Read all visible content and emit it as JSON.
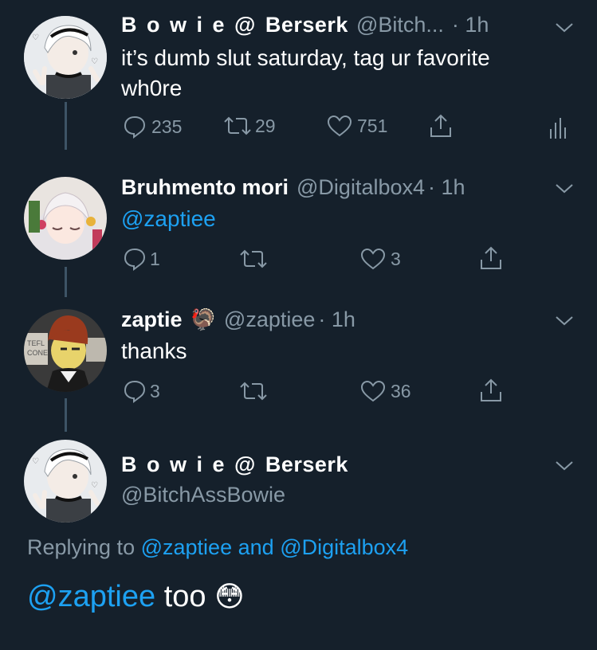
{
  "tweets": [
    {
      "name": "B o w i  e @ Berserk",
      "handle": "@Bitch...",
      "time": "· 1h",
      "text_lines": [
        "it’s dumb slut saturday, tag ur favorite",
        "wh0re"
      ],
      "replies": "235",
      "retweets": "29",
      "likes": "751"
    },
    {
      "name": "Bruhmento mori",
      "handle": "@Digitalbox4",
      "time": "· 1h",
      "text": "@zaptiee",
      "replies": "1",
      "likes": "3"
    },
    {
      "name": "zaptie",
      "emoji": "🦃",
      "handle": "@zaptiee",
      "time": "· 1h",
      "text": "thanks",
      "replies": "3",
      "likes": "36"
    }
  ],
  "main_tweet": {
    "name": "B o w i  e @ Berserk",
    "handle": "@BitchAssBowie",
    "replying_prefix": "Replying to",
    "replying_user1": "@zaptiee",
    "replying_and": "and",
    "replying_user2": "@Digitalbox4",
    "text_mention": "@zaptiee",
    "text_rest": "too",
    "text_emoji": "😳"
  },
  "icons": [
    "reply-icon",
    "retweet-icon",
    "like-icon",
    "share-icon",
    "analytics-icon",
    "chevron-down-icon"
  ],
  "colors": {
    "background": "#15202b",
    "secondary": "#8899a6",
    "link": "#1da1f2",
    "thread_line": "#3d5466"
  }
}
